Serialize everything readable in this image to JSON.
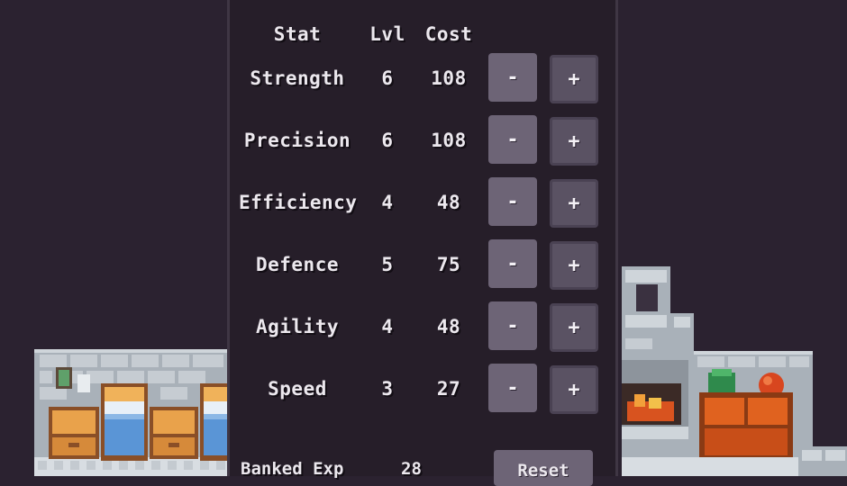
{
  "header": {
    "stat": "Stat",
    "level": "Lvl",
    "cost": "Cost"
  },
  "stats": [
    {
      "name": "Strength",
      "level": "6",
      "cost": "108"
    },
    {
      "name": "Precision",
      "level": "6",
      "cost": "108"
    },
    {
      "name": "Efficiency",
      "level": "4",
      "cost": "48"
    },
    {
      "name": "Defence",
      "level": "5",
      "cost": "75"
    },
    {
      "name": "Agility",
      "level": "4",
      "cost": "48"
    },
    {
      "name": "Speed",
      "level": "3",
      "cost": "27"
    }
  ],
  "buttons": {
    "minus": "-",
    "plus": "+"
  },
  "footer": {
    "exp_label": "Banked Exp",
    "exp_value": "28",
    "reset": "Reset"
  },
  "colors": {
    "background": "#2b2230",
    "panel": "#261e29",
    "button_minus": "#6d6476",
    "button_plus": "#5a5263",
    "text": "#ece8ee"
  }
}
